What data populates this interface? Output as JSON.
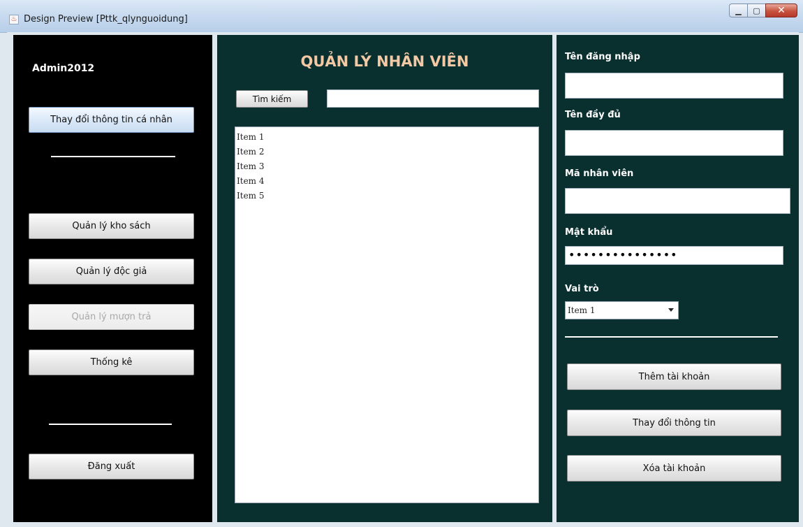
{
  "window": {
    "title": "Design Preview [Pttk_qlynguoidung]",
    "controls": [
      "minimize-icon",
      "maximize-icon",
      "close-icon"
    ]
  },
  "left": {
    "username": "Admin2012",
    "change_info_btn": "Thay đổi thông tin cá nhân",
    "nav": [
      {
        "label": "Quản lý kho sách",
        "enabled": true
      },
      {
        "label": "Quản lý độc giả",
        "enabled": true
      },
      {
        "label": "Quản lý mượn trả",
        "enabled": false
      },
      {
        "label": "Thống kê",
        "enabled": true
      }
    ],
    "logout_btn": "Đăng xuất"
  },
  "middle": {
    "heading": "QUẢN LÝ NHÂN VIÊN",
    "search_btn": "Tìm kiếm",
    "search_value": "",
    "list_items": [
      "Item 1",
      "Item 2",
      "Item 3",
      "Item 4",
      "Item 5"
    ]
  },
  "right": {
    "username_label": "Tên đăng nhập",
    "fullname_label": "Tên đầy đủ",
    "empid_label": "Mã nhân viên",
    "password_label": "Mật khẩu",
    "password_mask": "•••••••••••••••",
    "role_label": "Vai trò",
    "role_selected": "Item 1",
    "add_btn": "Thêm tài khoản",
    "edit_btn": "Thay đổi thông tin",
    "delete_btn": "Xóa tài khoản"
  },
  "colors": {
    "left_panel": "#000000",
    "main_panels": "#0a2f2f",
    "heading_text": "#f2c9a4"
  }
}
